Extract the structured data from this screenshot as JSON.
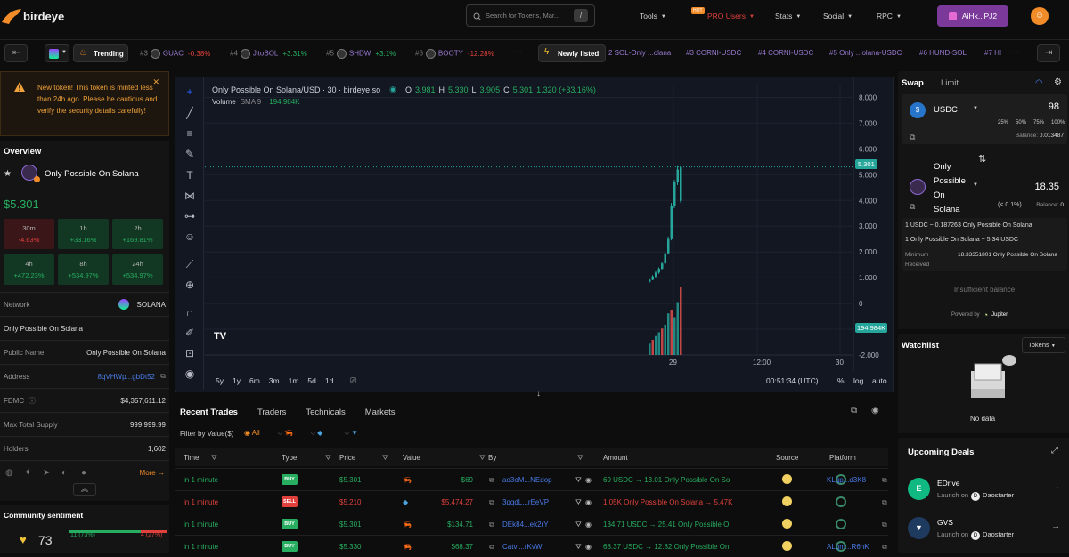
{
  "nav": {
    "brand": "birdeye",
    "search_placeholder": "Search for Tokens, Mar...",
    "search_key": "/",
    "tools": "Tools",
    "pro_badge": "HOT",
    "pro": "PRO Users",
    "stats": "Stats",
    "social": "Social",
    "rpc": "RPC",
    "wallet": "AiHk..iPJ2"
  },
  "ticker": {
    "trending": "Trending",
    "items": [
      {
        "rank": "#3",
        "name": "GUAC",
        "change": "-0.38%",
        "dir": "down"
      },
      {
        "rank": "#4",
        "name": "JitoSOL",
        "change": "+3.31%",
        "dir": "up"
      },
      {
        "rank": "#5",
        "name": "SHDW",
        "change": "+3.1%",
        "dir": "up"
      },
      {
        "rank": "#6",
        "name": "BOOTY",
        "change": "-12.28%",
        "dir": "down"
      }
    ],
    "newly": "Newly listed",
    "new_items": [
      "2 SOL-Only ...olana",
      "#3 CORNI-USDC",
      "#4 CORNI-USDC",
      "#5 Only ...olana-USDC",
      "#6 HUND-SOL",
      "#7 HI"
    ]
  },
  "alert": {
    "text": "New token! This token is minted less than 24h ago. Please be cautious and verify the security details carefully!"
  },
  "overview": {
    "title": "Overview",
    "token": "Only Possible On Solana",
    "price": "$5.301",
    "tf": [
      {
        "k": "30m",
        "v": "-4.63%",
        "dir": "down"
      },
      {
        "k": "1h",
        "v": "+33.16%",
        "dir": "up"
      },
      {
        "k": "2h",
        "v": "+169.81%",
        "dir": "up"
      },
      {
        "k": "4h",
        "v": "+472.23%",
        "dir": "up"
      },
      {
        "k": "8h",
        "v": "+534.97%",
        "dir": "up"
      },
      {
        "k": "24h",
        "v": "+534.97%",
        "dir": "up"
      }
    ],
    "network_label": "Network",
    "network": "SOLANA",
    "desc": "Only Possible On Solana",
    "rows": [
      {
        "k": "Public Name",
        "v": "Only Possible On Solana"
      },
      {
        "k": "Address",
        "v": "8qVHWp...gbDt52"
      },
      {
        "k": "FDMC",
        "v": "$4,357,611.12"
      },
      {
        "k": "Max Total Supply",
        "v": "999,999.99"
      },
      {
        "k": "Holders",
        "v": "1,602"
      }
    ],
    "more": "More"
  },
  "sentiment": {
    "title": "Community sentiment",
    "score": "73",
    "good": "11 (73%)",
    "bad": "4 (27%)",
    "good_frac": 0.73
  },
  "chart": {
    "title": "Only Possible On Solana/USD · 30 · birdeye.so",
    "o": "3.981",
    "h": "5.330",
    "l": "3.905",
    "c": "5.301",
    "chg": "1.320 (+33.16%)",
    "vol_label": "Volume",
    "sma": "SMA 9",
    "vol": "194.984K",
    "price_tag": "5.301",
    "vol_tag": "194.984K",
    "y_ticks": [
      "8.000",
      "7.000",
      "6.000",
      "5.000",
      "4.000",
      "3.000",
      "2.000",
      "1.000",
      "0",
      "-1.000",
      "-2.000"
    ],
    "x_ticks": [
      "29",
      "12:00",
      "30"
    ],
    "ranges": [
      "5y",
      "1y",
      "6m",
      "3m",
      "1m",
      "5d",
      "1d"
    ],
    "clock": "00:51:34 (UTC)",
    "pct": "%",
    "log": "log",
    "auto": "auto"
  },
  "chart_data": {
    "type": "candlestick",
    "candles": [
      [
        0.85,
        0.95,
        0.8,
        0.92
      ],
      [
        0.92,
        1.1,
        0.9,
        1.05
      ],
      [
        1.05,
        1.25,
        1.0,
        1.2
      ],
      [
        1.2,
        1.4,
        1.15,
        1.35
      ],
      [
        1.35,
        1.6,
        1.3,
        1.55
      ],
      [
        1.55,
        2.0,
        1.5,
        1.95
      ],
      [
        1.95,
        2.6,
        1.9,
        2.5
      ],
      [
        2.5,
        3.9,
        2.45,
        3.8
      ],
      [
        3.8,
        4.8,
        3.7,
        4.7
      ],
      [
        4.7,
        5.33,
        4.6,
        5.2
      ],
      [
        3.981,
        5.33,
        3.905,
        5.301
      ]
    ],
    "volumes": [
      0.15,
      0.2,
      0.25,
      0.3,
      0.35,
      0.4,
      0.55,
      0.6,
      0.5,
      0.7,
      0.9
    ],
    "ylim": [
      -2,
      8.5
    ]
  },
  "trades": {
    "tabs": [
      "Recent Trades",
      "Traders",
      "Technicals",
      "Markets"
    ],
    "filter": "Filter by Value($)",
    "all": "All",
    "cols": [
      "Time",
      "Type",
      "Price",
      "Value",
      "By",
      "Amount",
      "Source",
      "Platform"
    ],
    "rows": [
      {
        "time": "in 1 minute",
        "type": "BUY",
        "price": "$5.301",
        "value": "$69",
        "by": "ao3oM...NEdop",
        "amount": "69 USDC → 13.01 Only Possible On So",
        "plat": "KLqp...d3K8"
      },
      {
        "time": "in 1 minute",
        "type": "SELL",
        "price": "$5.210",
        "value": "$5,474.27",
        "by": "3qqdL...rEeVP",
        "amount": "1.05K Only Possible On Solana → 5.47K",
        "plat": ""
      },
      {
        "time": "in 1 minute",
        "type": "BUY",
        "price": "$5.301",
        "value": "$134.71",
        "by": "DEk84...ek2rY",
        "amount": "134.71 USDC → 25.41 Only Possible O",
        "plat": ""
      },
      {
        "time": "in 1 minute",
        "type": "BUY",
        "price": "$5.330",
        "value": "$68.37",
        "by": "Catvi...rKvW",
        "amount": "68.37 USDC → 12.82 Only Possible On",
        "plat": "ALqm...R6hK"
      }
    ]
  },
  "swap": {
    "tab1": "Swap",
    "tab2": "Limit",
    "from": "USDC",
    "from_amt": "98",
    "pcts": [
      "25%",
      "50%",
      "75%",
      "100%"
    ],
    "bal_label": "Balance:",
    "from_bal": "0.013487",
    "to": "Only Possible On Solana",
    "to_amt": "18.35",
    "slip": "(< 0.1%)",
    "to_bal": "0",
    "rate1": "1 USDC ~ 0.187263 Only Possible On Solana",
    "rate2": "1 Only Possible On Solana ~ 5.34 USDC",
    "min_label": "Minimum Received",
    "min_val": "18.33351801 Only Possible On Solana",
    "insuf": "Insufficient balance",
    "powered": "Powered by",
    "jupiter": "Jupiter"
  },
  "watch": {
    "title": "Watchlist",
    "sel": "Tokens",
    "nodata": "No data"
  },
  "deals": {
    "title": "Upcoming Deals",
    "items": [
      {
        "name": "EDrive",
        "launch": "Launch on",
        "dao": "Daostarter"
      },
      {
        "name": "GVS",
        "launch": "Launch on",
        "dao": "Daostarter"
      }
    ]
  }
}
